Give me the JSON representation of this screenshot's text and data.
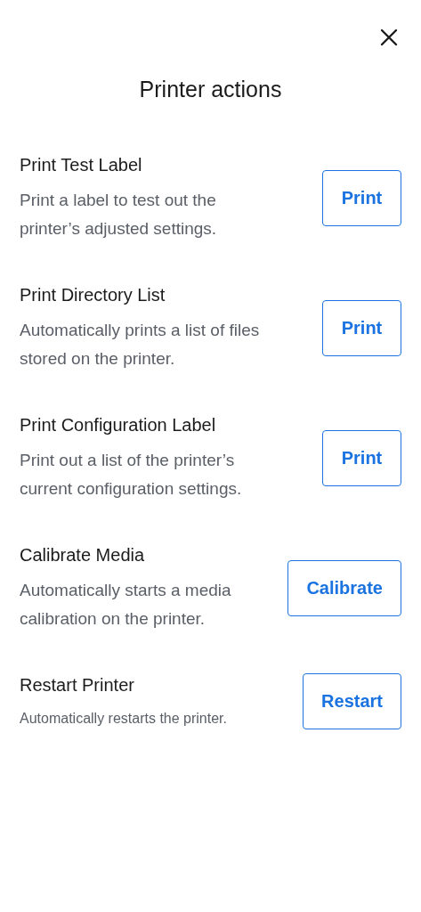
{
  "title": "Printer actions",
  "actions": [
    {
      "kind": "standard",
      "name": "Print Test Label",
      "description": "Print a label to test out the printer’s adjusted settings.",
      "button": "Print"
    },
    {
      "kind": "standard",
      "name": "Print Directory List",
      "description": "Automatically prints a list of files stored on the printer.",
      "button": "Print"
    },
    {
      "kind": "standard",
      "name": "Print Configuration Label",
      "description": "Print out a list of the printer’s current configuration settings.",
      "button": "Print"
    },
    {
      "kind": "standard",
      "name": "Calibrate Media",
      "description": "Automatically starts a media calibration on the printer.",
      "button": "Calibrate"
    },
    {
      "kind": "compact",
      "name": "Restart Printer",
      "description": "Automatically restarts the printer.",
      "button": "Restart"
    }
  ]
}
